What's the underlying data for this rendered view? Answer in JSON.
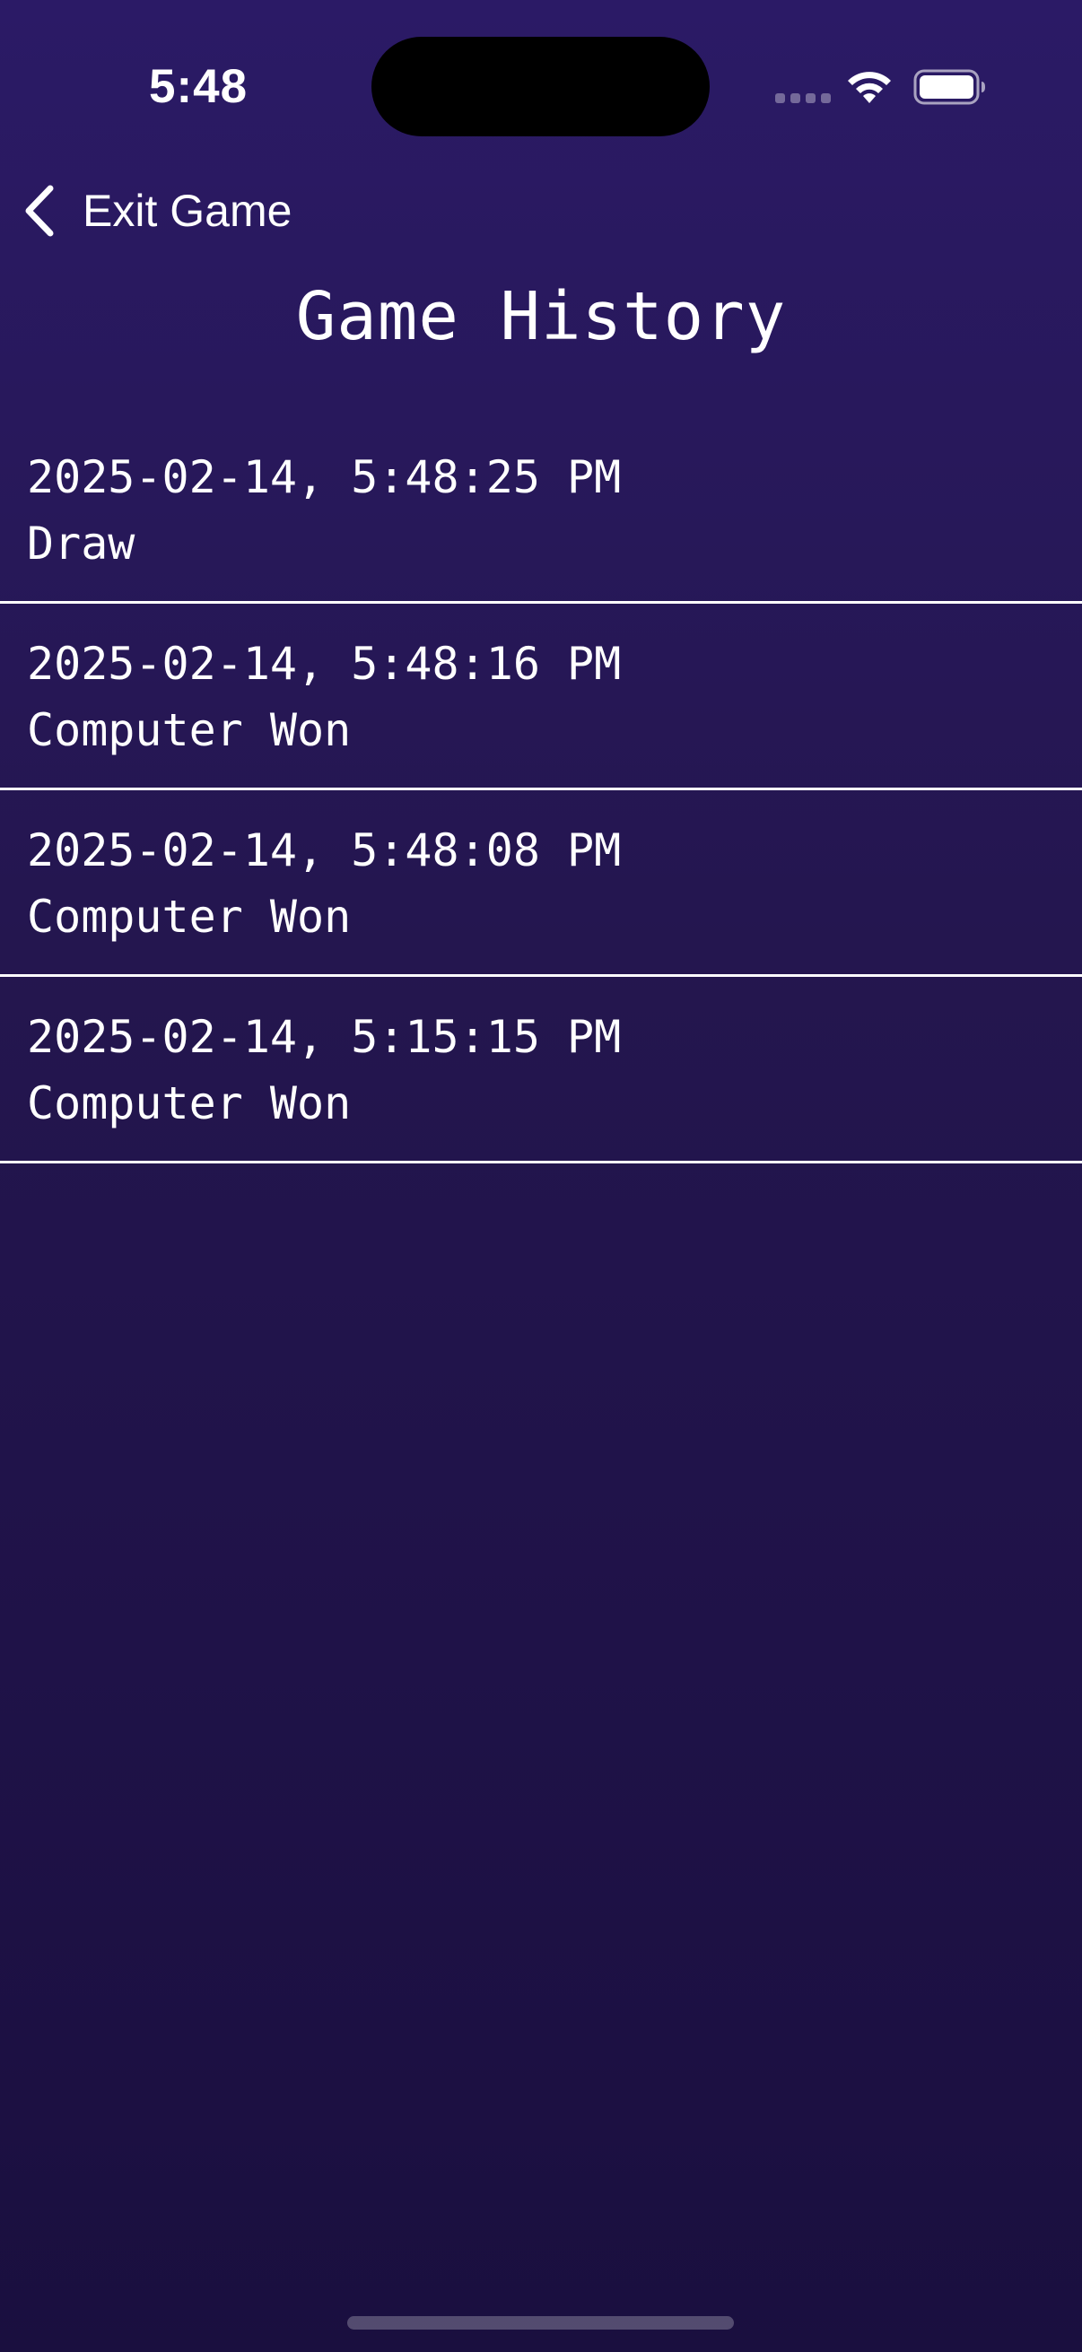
{
  "status_bar": {
    "time": "5:48",
    "icons": [
      "cellular-dots-icon",
      "wifi-icon",
      "battery-icon"
    ]
  },
  "nav": {
    "back_label": "Exit Game",
    "back_icon": "chevron-left-icon"
  },
  "page": {
    "title": "Game History"
  },
  "history": [
    {
      "date": "2025-02-14, 5:48:25 PM",
      "result": "Draw"
    },
    {
      "date": "2025-02-14, 5:48:16 PM",
      "result": "Computer Won"
    },
    {
      "date": "2025-02-14, 5:48:08 PM",
      "result": "Computer Won"
    },
    {
      "date": "2025-02-14, 5:15:15 PM",
      "result": "Computer Won"
    }
  ],
  "colors": {
    "background_top": "#2b1a66",
    "background_bottom": "#1a0f3f",
    "text": "#ffffff",
    "divider": "#ffffff"
  }
}
